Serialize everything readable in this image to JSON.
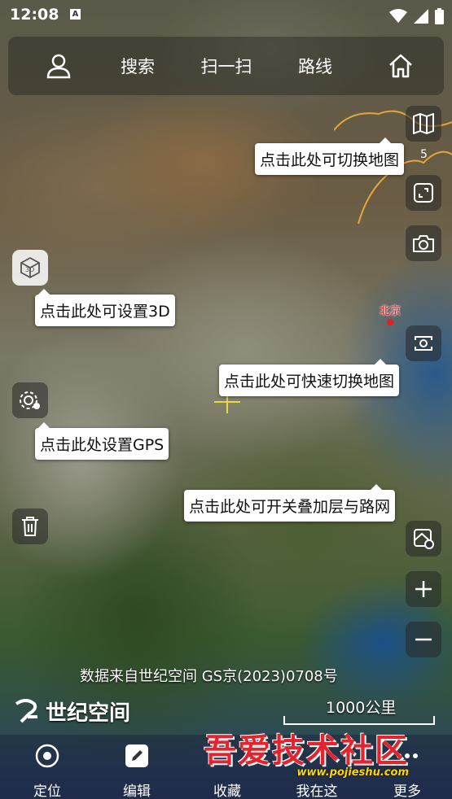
{
  "status": {
    "time": "12:08",
    "a_badge": "A"
  },
  "topbar": {
    "search": "搜索",
    "scan": "扫一扫",
    "route": "路线"
  },
  "tips": {
    "switch_map": "点击此处可切换地图",
    "set_3d": "点击此处可设置3D",
    "quick_switch": "点击此处可快速切换地图",
    "set_gps": "点击此处设置GPS",
    "overlay": "点击此处可开关叠加层与路网"
  },
  "map": {
    "city_label": "北京",
    "edge_number": "5",
    "source_text": "数据来自世纪空间 GS京(2023)0708号",
    "brand_name": "世纪空间",
    "scale_label": "1000公里",
    "accent_color": "#e8d84a"
  },
  "bottombar": {
    "locate": "定位",
    "edit": "编辑",
    "favorites": "收藏",
    "here": "我在这",
    "more": "更多"
  },
  "watermark": {
    "text": "吾爱技术社区",
    "url": "www.pojieshu.com"
  }
}
